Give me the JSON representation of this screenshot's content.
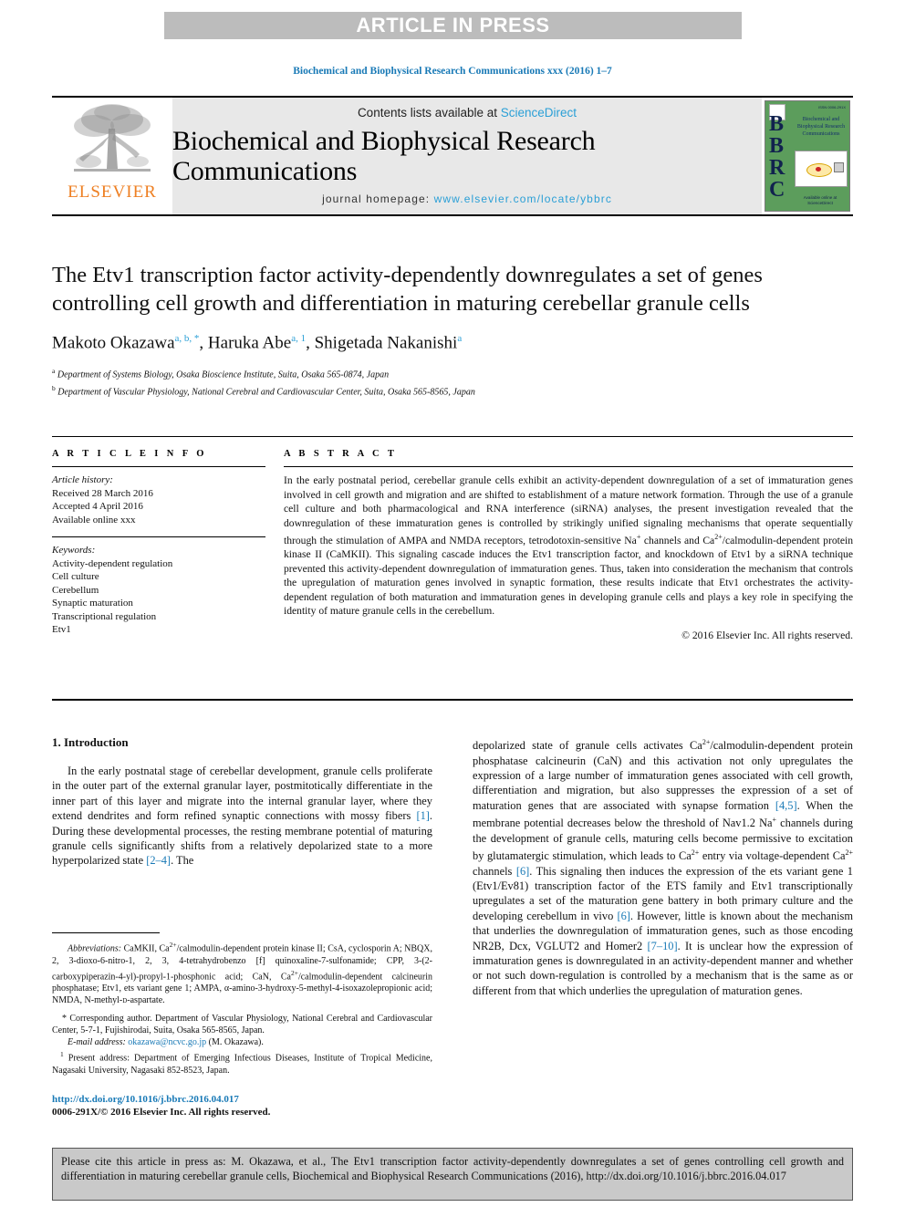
{
  "banner": {
    "label": "ARTICLE IN PRESS"
  },
  "running_head": "Biochemical and Biophysical Research Communications xxx (2016) 1–7",
  "masthead": {
    "publisher_name": "ELSEVIER",
    "contents_prefix": "Contents lists available at ",
    "contents_link": "ScienceDirect",
    "journal_title": "Biochemical and Biophysical Research Communications",
    "homepage_prefix": "journal homepage: ",
    "homepage_url": "www.elsevier.com/locate/ybbrc",
    "cover": {
      "letters": "BBRC",
      "title_lines": "Biochemical and Biophysical Research Communications",
      "top_right": "ISSN 0006-291X",
      "bottom": "Available online at\nScienceDirect"
    },
    "colors": {
      "link": "#2a9fd6",
      "elsevier_orange": "#ee7f22",
      "cover_green": "#5c9d5c",
      "band_gray": "#e8e8e8"
    }
  },
  "article": {
    "title": "The Etv1 transcription factor activity-dependently downregulates a set of genes controlling cell growth and differentiation in maturing cerebellar granule cells",
    "authors": [
      {
        "name": "Makoto Okazawa",
        "marks": "a, b, *"
      },
      {
        "name": "Haruka Abe",
        "marks": "a, 1"
      },
      {
        "name": "Shigetada Nakanishi",
        "marks": "a"
      }
    ],
    "affiliations": [
      {
        "mark": "a",
        "text": "Department of Systems Biology, Osaka Bioscience Institute, Suita, Osaka 565-0874, Japan"
      },
      {
        "mark": "b",
        "text": "Department of Vascular Physiology, National Cerebral and Cardiovascular Center, Suita, Osaka 565-8565, Japan"
      }
    ]
  },
  "article_info": {
    "heading": "A R T I C L E   I N F O",
    "history_label": "Article history:",
    "history": [
      "Received 28 March 2016",
      "Accepted 4 April 2016",
      "Available online xxx"
    ],
    "keywords_label": "Keywords:",
    "keywords": [
      "Activity-dependent regulation",
      "Cell culture",
      "Cerebellum",
      "Synaptic maturation",
      "Transcriptional regulation",
      "Etv1"
    ]
  },
  "abstract": {
    "heading": "A B S T R A C T",
    "part1": "In the early postnatal period, cerebellar granule cells exhibit an activity-dependent downregulation of a set of immaturation genes involved in cell growth and migration and are shifted to establishment of a mature network formation. Through the use of a granule cell culture and both pharmacological and RNA interference (siRNA) analyses, the present investigation revealed that the downregulation of these immaturation genes is controlled by strikingly unified signaling mechanisms that operate sequentially through the stimulation of AMPA and NMDA receptors, tetrodotoxin-sensitive Na",
    "sup1": "+",
    "part2": " channels and Ca",
    "sup2": "2+",
    "part3": "/calmodulin-dependent protein kinase II (CaMKII). This signaling cascade induces the Etv1 transcription factor, and knockdown of Etv1 by a siRNA technique prevented this activity-dependent downregulation of immaturation genes. Thus, taken into consideration the mechanism that controls the upregulation of maturation genes involved in synaptic formation, these results indicate that Etv1 orchestrates the activity-dependent regulation of both maturation and immaturation genes in developing granule cells and plays a key role in specifying the identity of mature granule cells in the cerebellum.",
    "copyright": "© 2016 Elsevier Inc. All rights reserved."
  },
  "introduction": {
    "heading": "1.  Introduction",
    "left_para1_a": "In the early postnatal stage of cerebellar development, granule cells proliferate in the outer part of the external granular layer, postmitotically differentiate in the inner part of this layer and migrate into the internal granular layer, where they extend dendrites and form refined synaptic connections with mossy fibers ",
    "left_ref1": "[1]",
    "left_para1_b": ". During these developmental processes, the resting membrane potential of maturing granule cells significantly shifts from a relatively depolarized state to a more hyperpolarized state ",
    "left_ref2": "[2–4]",
    "left_para1_c": ". The",
    "right_a": "depolarized state of granule cells activates Ca",
    "right_sup1": "2+",
    "right_b": "/calmodulin-dependent protein phosphatase calcineurin (CaN) and this activation not only upregulates the expression of a large number of immaturation genes associated with cell growth, differentiation and migration, but also suppresses the expression of a set of maturation genes that are associated with synapse formation ",
    "right_ref1": "[4,5]",
    "right_c": ". When the membrane potential decreases below the threshold of Nav1.2 Na",
    "right_sup2": "+",
    "right_d": " channels during the development of granule cells, maturing cells become permissive to excitation by glutamatergic stimulation, which leads to Ca",
    "right_sup3": "2+",
    "right_e": " entry via voltage-dependent Ca",
    "right_sup4": "2+",
    "right_f": " channels ",
    "right_ref2": "[6]",
    "right_g": ". This signaling then induces the expression of the ets variant gene 1 (Etv1/Ev81) transcription factor of the ETS family and Etv1 transcriptionally upregulates a set of the maturation gene battery in both primary culture and the developing cerebellum in vivo ",
    "right_ref3": "[6]",
    "right_h": ". However, little is known about the mechanism that underlies the downregulation of immaturation genes, such as those encoding NR2B, Dcx, VGLUT2 and Homer2 ",
    "right_ref4": "[7–10]",
    "right_i": ". It is unclear how the expression of immaturation genes is downregulated in an activity-dependent manner and whether or not such down-regulation is controlled by a mechanism that is the same as or different from that which underlies the upregulation of maturation genes."
  },
  "footnotes": {
    "abbrev_label": "Abbreviations:",
    "abbrev_a": " CaMKII, Ca",
    "abbrev_sup1": "2+",
    "abbrev_b": "/calmodulin-dependent protein kinase II; CsA, cyclosporin A; NBQX, 2, 3-dioxo-6-nitro-1, 2, 3, 4-tetrahydrobenzo [f] quinoxaline-7-sulfonamide; CPP, 3-(2-carboxypiperazin-4-yl)-propyl-1-phosphonic acid; CaN, Ca",
    "abbrev_sup2": "2+",
    "abbrev_c": "/calmodulin-dependent calcineurin phosphatase; Etv1, ets variant gene 1; AMPA, α-amino-3-hydroxy-5-methyl-4-isoxazolepropionic acid; NMDA, N-methyl-",
    "abbrev_d": "d",
    "abbrev_e": "-aspartate.",
    "corresponding_star": "*",
    "corresponding": " Corresponding author. Department of Vascular Physiology, National Cerebral and Cardiovascular Center, 5-7-1, Fujishirodai, Suita, Osaka 565-8565, Japan.",
    "email_label": "E-mail address:",
    "email": "okazawa@ncvc.go.jp",
    "email_suffix": " (M. Okazawa).",
    "present_mark": "1",
    "present_address": " Present address: Department of Emerging Infectious Diseases, Institute of Tropical Medicine, Nagasaki University, Nagasaki 852-8523, Japan.",
    "doi": "http://dx.doi.org/10.1016/j.bbrc.2016.04.017",
    "issn": "0006-291X/© 2016 Elsevier Inc. All rights reserved."
  },
  "cite_box": {
    "text": "Please cite this article in press as: M. Okazawa, et al., The Etv1 transcription factor activity-dependently downregulates a set of genes controlling cell growth and differentiation in maturing cerebellar granule cells, Biochemical and Biophysical Research Communications (2016), http://dx.doi.org/10.1016/j.bbrc.2016.04.017"
  }
}
